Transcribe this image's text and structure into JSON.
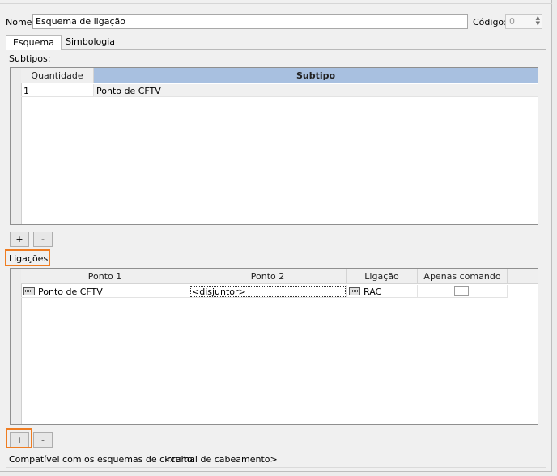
{
  "header": {
    "name_label": "Nome:",
    "name_value": "Esquema de ligação",
    "code_label": "Código:",
    "code_value": "0"
  },
  "tabs": [
    {
      "label": "Esquema",
      "active": true
    },
    {
      "label": "Simbologia",
      "active": false
    }
  ],
  "subtypes": {
    "label": "Subtipos:",
    "columns": [
      "Quantidade",
      "Subtipo"
    ],
    "rows": [
      {
        "quantidade": "1",
        "subtipo": "Ponto de CFTV"
      }
    ],
    "add_label": "+",
    "remove_label": "-"
  },
  "connections": {
    "label": "Ligações:",
    "columns": [
      "Ponto 1",
      "Ponto 2",
      "Ligação",
      "Apenas comando"
    ],
    "rows": [
      {
        "ponto1": "Ponto de CFTV",
        "ponto2": "<disjuntor>",
        "ligacao": "RAC",
        "apenas_comando": false
      }
    ],
    "add_label": "+",
    "remove_label": "-"
  },
  "footer": {
    "compat_label": "Compatível com os esquemas de circuito:",
    "compat_value": "<ramal de cabeamento>"
  },
  "colors": {
    "highlight": "#ef7d22",
    "selected_header": "#a8c0e0"
  }
}
